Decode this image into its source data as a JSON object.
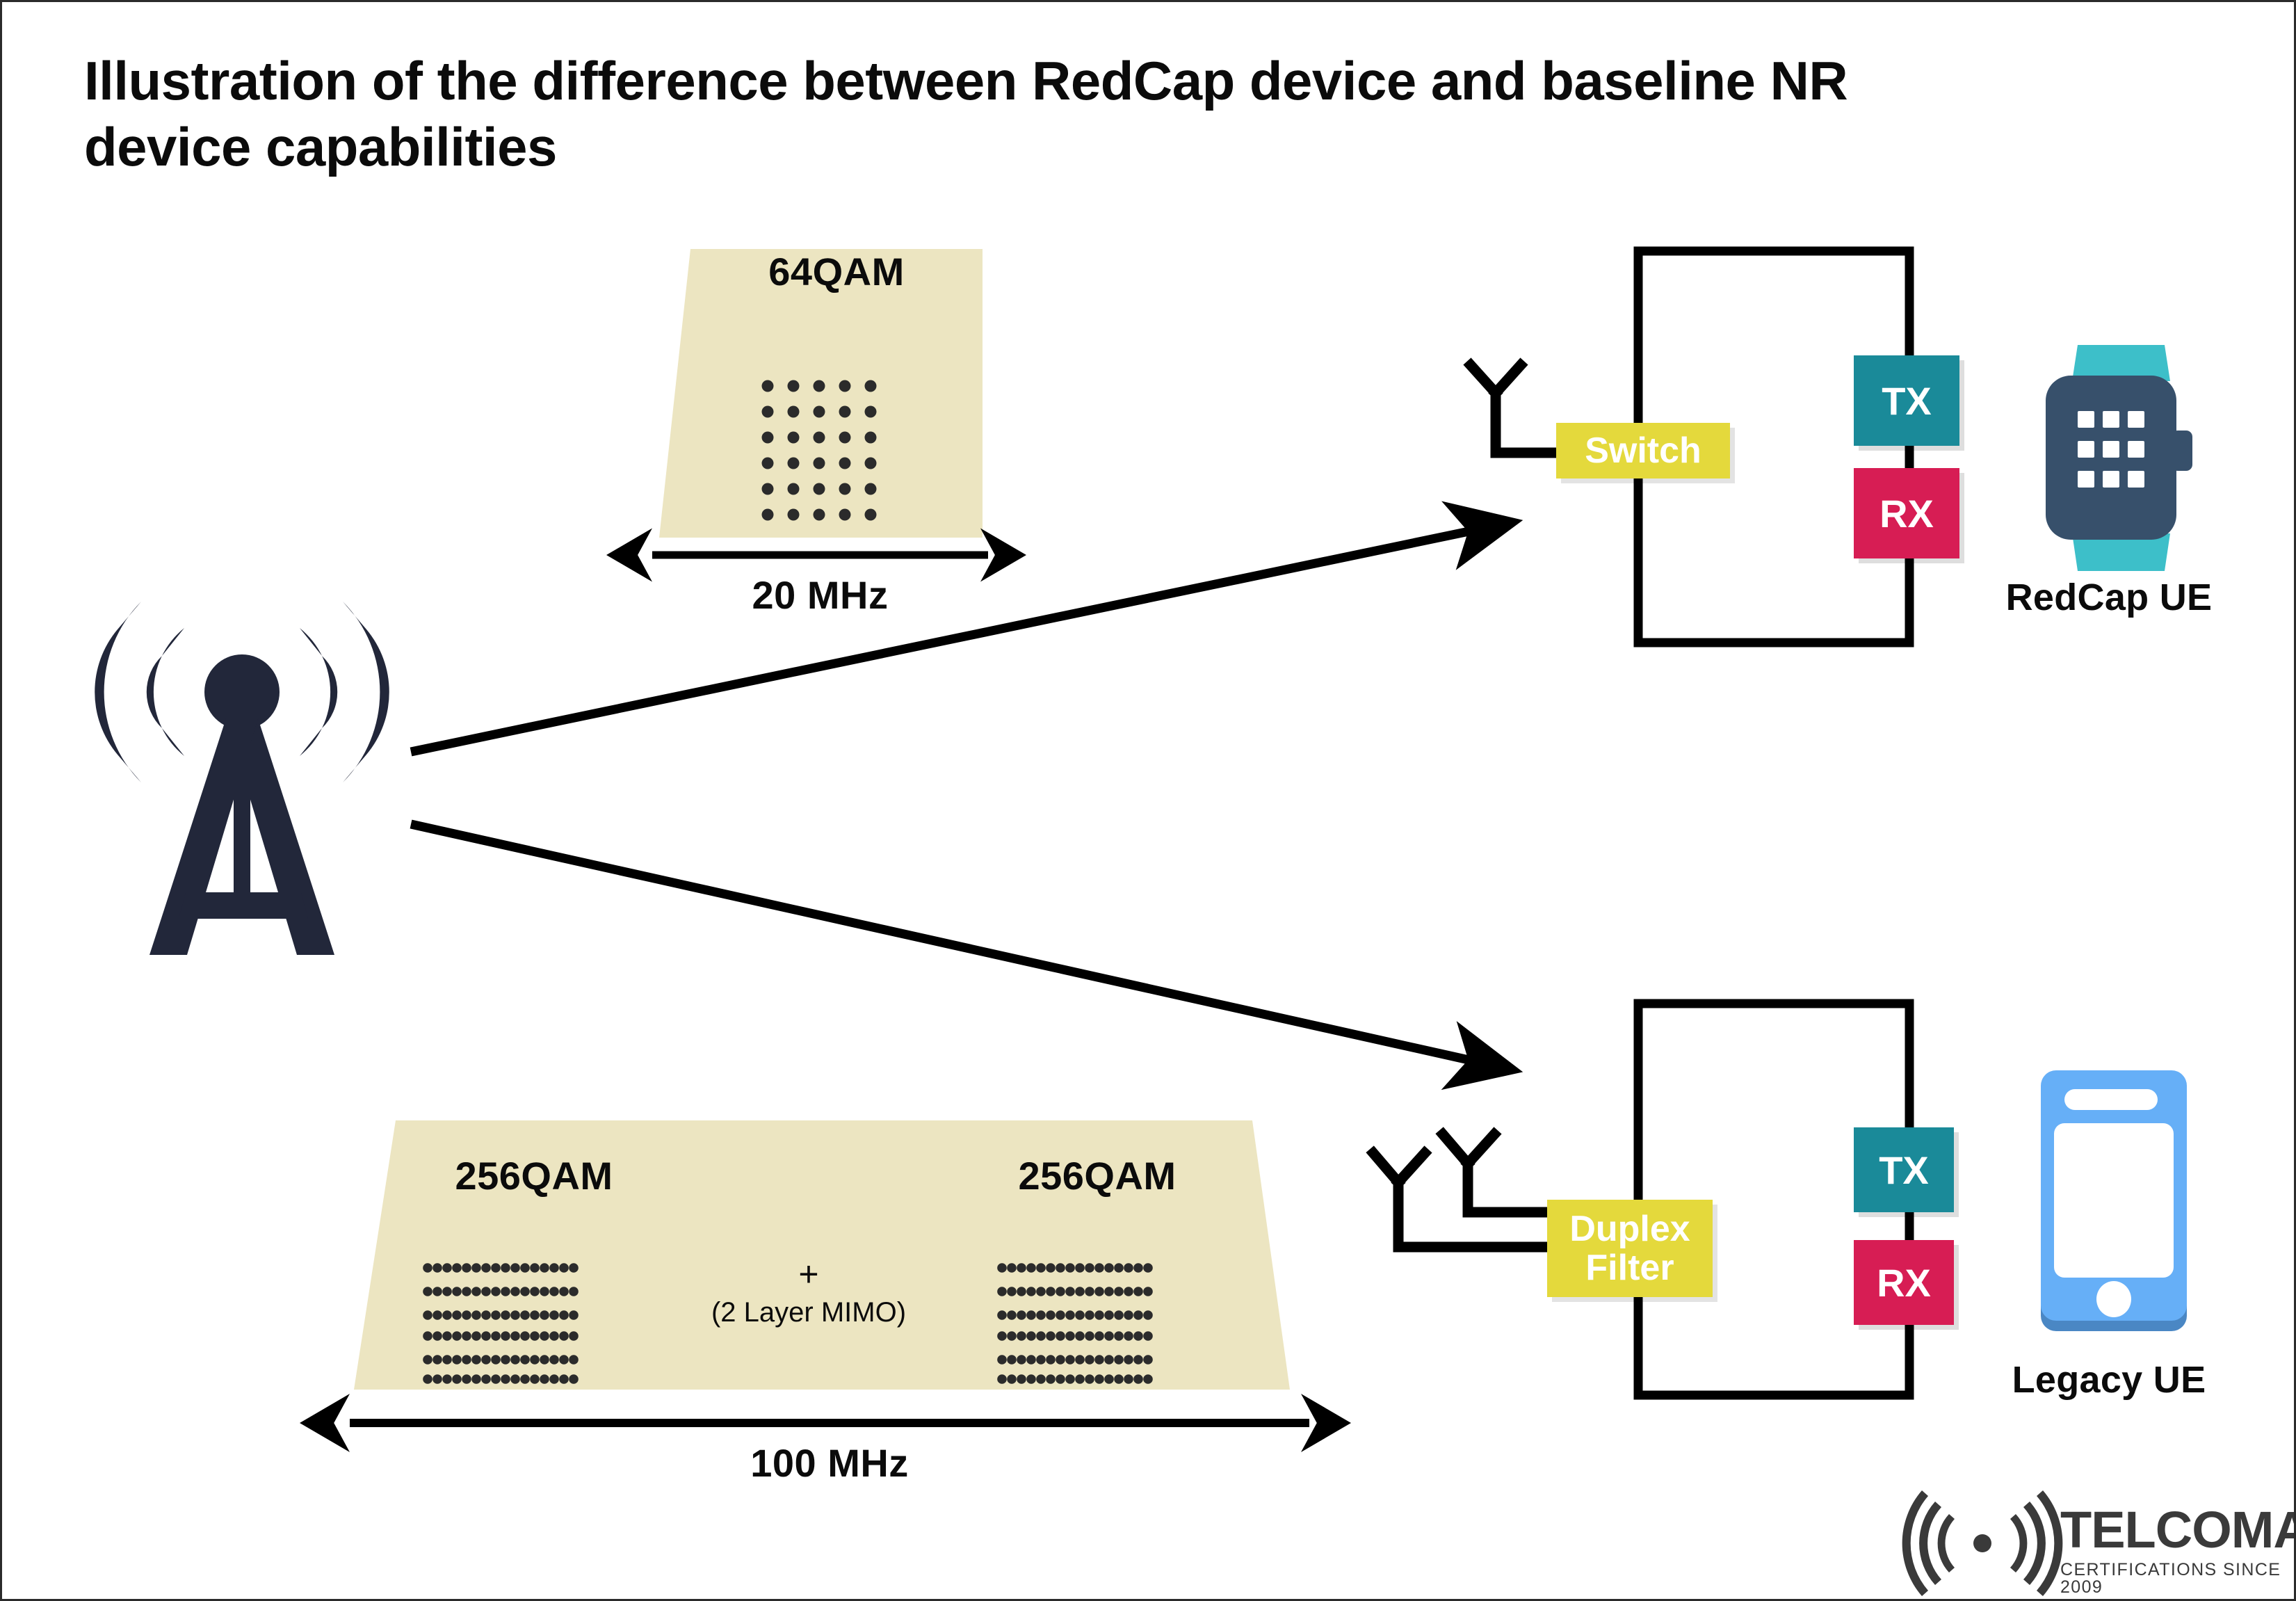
{
  "page": {
    "title": "Illustration of the difference between RedCap device and baseline NR device capabilities",
    "background_color": "#ffffff",
    "border_color": "#2b2b2b"
  },
  "colors": {
    "band_fill": "#ece5c1",
    "dot": "#2b2b2b",
    "tower": "#22273a",
    "tx": "#1a8a99",
    "rx": "#d71d54",
    "yellow": "#e4d93c",
    "watch_body": "#37506b",
    "watch_strap": "#3dbfc9",
    "phone_body": "#66aff7",
    "phone_shadow": "#4a87c4",
    "line": "#000000"
  },
  "source": {
    "icon": "tower-icon",
    "name": "base-station"
  },
  "redcap_branch": {
    "band": {
      "qam_label": "64QAM",
      "bandwidth_label": "20 MHz",
      "constellation": {
        "columns": 5,
        "rows": 6,
        "points": 30
      }
    },
    "rf": {
      "antenna_count": 1,
      "filter_label": "Switch",
      "tx_label": "TX",
      "rx_label": "RX"
    },
    "device": {
      "label": "RedCap UE",
      "icon": "smartwatch-icon"
    }
  },
  "legacy_branch": {
    "band": {
      "qam_label_left": "256QAM",
      "qam_label_right": "256QAM",
      "mimo_plus": "+",
      "mimo_note": "(2 Layer MIMO)",
      "bandwidth_label": "100 MHz",
      "constellation_left": {
        "columns": 16,
        "rows": 6,
        "points": 96
      },
      "constellation_right": {
        "columns": 16,
        "rows": 6,
        "points": 96
      }
    },
    "rf": {
      "antenna_count": 2,
      "filter_label": "Duplex\nFilter",
      "filter_line1": "Duplex",
      "filter_line2": "Filter",
      "tx_label": "TX",
      "rx_label": "RX"
    },
    "device": {
      "label": "Legacy UE",
      "icon": "smartphone-icon"
    }
  },
  "logo": {
    "icon": "radio-wave-icon",
    "brand": "TELCOMA",
    "tagline": "CERTIFICATIONS SINCE 2009"
  }
}
